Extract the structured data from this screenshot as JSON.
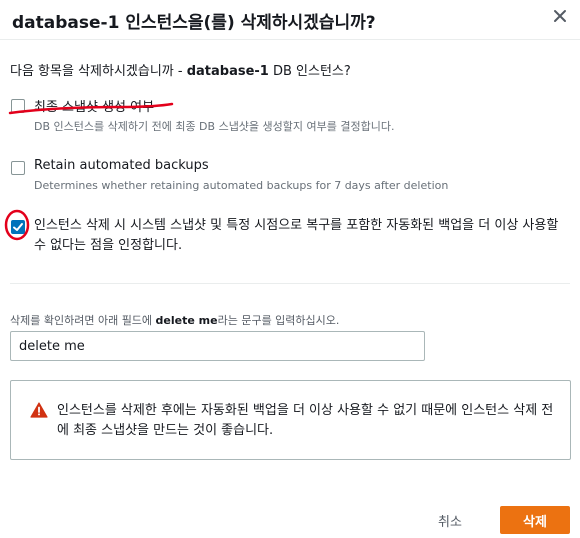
{
  "dialog": {
    "title": "database-1 인스턴스을(를) 삭제하시겠습니까?",
    "prompt": {
      "prefix": "다음 항목을 삭제하시겠습니까 - ",
      "instance": "database-1",
      "suffix": " DB 인스턴스?"
    },
    "options": [
      {
        "label": "최종 스냅샷 생성 여부",
        "description": "DB 인스턴스를 삭제하기 전에 최종 DB 스냅샷을 생성할지 여부를 결정합니다.",
        "checked": false
      },
      {
        "label": "Retain automated backups",
        "description": "Determines whether retaining automated backups for 7 days after deletion",
        "checked": false
      },
      {
        "label": "인스턴스 삭제 시 시스템 스냅샷 및 특정 시점으로 복구를 포함한 자동화된 백업을 더 이상 사용할 수 없다는 점을 인정합니다.",
        "checked": true
      }
    ],
    "confirm": {
      "prefix": "삭제를 확인하려면 아래 필드에 ",
      "keyword": "delete me",
      "suffix": "라는 문구를 입력하십시오.",
      "value": "delete me"
    },
    "warning": "인스턴스를 삭제한 후에는 자동화된 백업을 더 이상 사용할 수 없기 때문에 인스턴스 삭제 전에 최종 스냅샷을 만드는 것이 좋습니다.",
    "buttons": {
      "cancel": "취소",
      "delete": "삭제"
    }
  },
  "colors": {
    "primary": "#ec7211",
    "checkbox_checked": "#0073bb",
    "warning": "#d13212",
    "annotation": "#e3001b"
  },
  "icons": {
    "close": "close-icon",
    "check": "check-icon",
    "warning": "warning-icon"
  }
}
